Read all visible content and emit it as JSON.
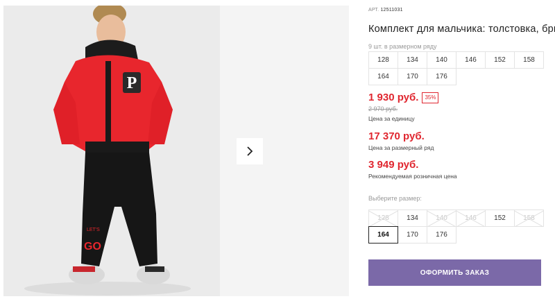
{
  "gallery": {
    "next_icon": "chevron-right-icon",
    "photo_print": {
      "logo_letter": "P",
      "pants_text_top": "LET'S",
      "pants_text_mid": "GO"
    }
  },
  "product": {
    "art_label": "АРТ.",
    "art_value": "12511031",
    "title": "Комплект для мальчика: толстовка, брюки",
    "pack_note": "9 шт. в размерном ряду",
    "pack_sizes": [
      "128",
      "134",
      "140",
      "146",
      "152",
      "158",
      "164",
      "170",
      "176"
    ]
  },
  "prices": {
    "unit_price": "1 930 руб.",
    "discount": "35%",
    "old_price": "2 970 руб.",
    "unit_caption": "Цена за единицу",
    "pack_price": "17 370 руб.",
    "pack_caption": "Цена за размерный ряд",
    "rrp_price": "3 949 руб.",
    "rrp_caption": "Рекомендуемая розничная цена"
  },
  "size_select": {
    "label": "Выберите размер:",
    "sizes": [
      {
        "label": "128",
        "available": false
      },
      {
        "label": "134",
        "available": true
      },
      {
        "label": "140",
        "available": false
      },
      {
        "label": "146",
        "available": false
      },
      {
        "label": "152",
        "available": true
      },
      {
        "label": "158",
        "available": false
      },
      {
        "label": "164",
        "available": true,
        "selected": true
      },
      {
        "label": "170",
        "available": true
      },
      {
        "label": "176",
        "available": true
      }
    ]
  },
  "actions": {
    "order_label": "ОФОРМИТЬ ЗАКАЗ"
  },
  "colors": {
    "accent_price": "#e0262f",
    "order_button": "#7b69a8",
    "jacket": "#e8262d"
  }
}
